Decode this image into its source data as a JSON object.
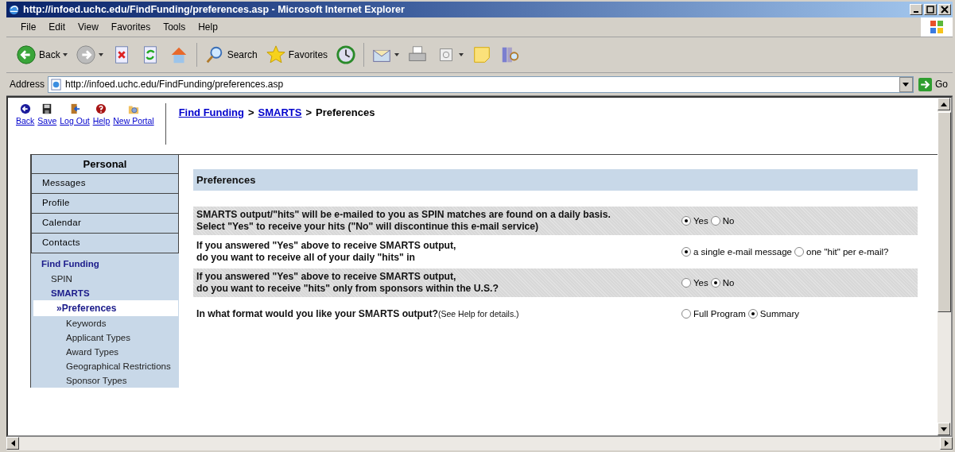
{
  "window": {
    "title": "http://infoed.uchc.edu/FindFunding/preferences.asp - Microsoft Internet Explorer"
  },
  "menu": [
    "File",
    "Edit",
    "View",
    "Favorites",
    "Tools",
    "Help"
  ],
  "toolbar": [
    {
      "kind": "back",
      "label": "Back",
      "dropdown": true
    },
    {
      "kind": "forward",
      "dropdown": true
    },
    {
      "kind": "stop"
    },
    {
      "kind": "refresh"
    },
    {
      "kind": "home"
    },
    {
      "kind": "search",
      "label": "Search"
    },
    {
      "kind": "favorites",
      "label": "Favorites"
    },
    {
      "kind": "history"
    },
    {
      "kind": "mail",
      "dropdown": true
    },
    {
      "kind": "print"
    },
    {
      "kind": "edit",
      "dropdown": true
    },
    {
      "kind": "note"
    },
    {
      "kind": "research"
    }
  ],
  "address": {
    "label": "Address",
    "value": "http://infoed.uchc.edu/FindFunding/preferences.asp",
    "go": "Go"
  },
  "portal_toolbar": [
    {
      "kind": "back",
      "label": "Back"
    },
    {
      "kind": "save",
      "label": "Save"
    },
    {
      "kind": "logout",
      "label": "Log Out"
    },
    {
      "kind": "help",
      "label": "Help"
    },
    {
      "kind": "portal",
      "label": "New Portal"
    }
  ],
  "breadcrumb": {
    "separator": ">",
    "items": [
      {
        "label": "Find Funding",
        "link": true
      },
      {
        "label": "SMARTS",
        "link": true
      },
      {
        "label": "Preferences",
        "link": false
      }
    ]
  },
  "sidebar": {
    "title": "Personal",
    "items": [
      {
        "label": "Messages",
        "kind": "tab"
      },
      {
        "label": "Profile",
        "kind": "tab"
      },
      {
        "label": "Calendar",
        "kind": "tab"
      },
      {
        "label": "Contacts",
        "kind": "tab"
      },
      {
        "label": "Find Funding",
        "kind": "section",
        "children": [
          {
            "label": "SPIN",
            "selected": false
          },
          {
            "label": "SMARTS",
            "selected": false,
            "children": [
              {
                "label": "Preferences",
                "selected": true,
                "marker": "»"
              },
              {
                "label": "Keywords",
                "selected": false
              },
              {
                "label": "Applicant Types",
                "selected": false
              },
              {
                "label": "Award Types",
                "selected": false
              },
              {
                "label": "Geographical Restrictions",
                "selected": false
              },
              {
                "label": "Sponsor Types",
                "selected": false
              }
            ]
          }
        ]
      }
    ]
  },
  "panel": {
    "title": "Preferences",
    "questions": [
      {
        "lines": [
          "SMARTS output/\"hits\" will be e-mailed to you as SPIN matches are found on a daily basis.",
          "Select \"Yes\" to receive your hits (\"No\" will discontinue this e-mail service)"
        ],
        "options": [
          {
            "label": "Yes",
            "selected": true
          },
          {
            "label": "No",
            "selected": false
          }
        ]
      },
      {
        "lines": [
          "If you answered \"Yes\" above to receive SMARTS output,",
          "do you want to receive all of your daily \"hits\" in"
        ],
        "options": [
          {
            "label": "a single e-mail message",
            "selected": true
          },
          {
            "label": "one \"hit\" per e-mail?",
            "selected": false
          }
        ]
      },
      {
        "lines": [
          "If you answered \"Yes\" above to receive SMARTS output,",
          "do you want to receive \"hits\" only from sponsors within the U.S.?"
        ],
        "options": [
          {
            "label": "Yes",
            "selected": false
          },
          {
            "label": "No",
            "selected": true
          }
        ]
      },
      {
        "lines": [
          "In what format would you like your SMARTS output?"
        ],
        "note": "(See Help for details.)",
        "options": [
          {
            "label": "Full Program",
            "selected": false
          },
          {
            "label": "Summary",
            "selected": true
          }
        ]
      }
    ]
  }
}
